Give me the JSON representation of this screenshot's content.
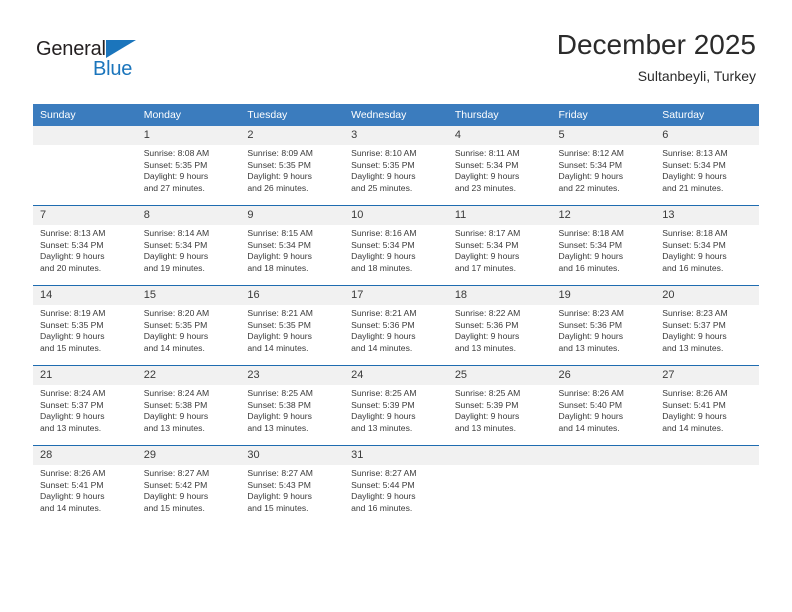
{
  "brand": {
    "name_part1": "General",
    "name_part2": "Blue",
    "accent_color": "#1b75bc"
  },
  "header": {
    "title": "December 2025",
    "location": "Sultanbeyli, Turkey"
  },
  "theme": {
    "header_bg": "#3b7cbe",
    "rule_color": "#1f6cb0",
    "daynum_bg": "#f1f1f1",
    "text_color": "#3a3a3a"
  },
  "weekday_headers": [
    "Sunday",
    "Monday",
    "Tuesday",
    "Wednesday",
    "Thursday",
    "Friday",
    "Saturday"
  ],
  "weeks": [
    [
      {
        "day": "",
        "lines": []
      },
      {
        "day": "1",
        "lines": [
          "Sunrise: 8:08 AM",
          "Sunset: 5:35 PM",
          "Daylight: 9 hours",
          "and 27 minutes."
        ]
      },
      {
        "day": "2",
        "lines": [
          "Sunrise: 8:09 AM",
          "Sunset: 5:35 PM",
          "Daylight: 9 hours",
          "and 26 minutes."
        ]
      },
      {
        "day": "3",
        "lines": [
          "Sunrise: 8:10 AM",
          "Sunset: 5:35 PM",
          "Daylight: 9 hours",
          "and 25 minutes."
        ]
      },
      {
        "day": "4",
        "lines": [
          "Sunrise: 8:11 AM",
          "Sunset: 5:34 PM",
          "Daylight: 9 hours",
          "and 23 minutes."
        ]
      },
      {
        "day": "5",
        "lines": [
          "Sunrise: 8:12 AM",
          "Sunset: 5:34 PM",
          "Daylight: 9 hours",
          "and 22 minutes."
        ]
      },
      {
        "day": "6",
        "lines": [
          "Sunrise: 8:13 AM",
          "Sunset: 5:34 PM",
          "Daylight: 9 hours",
          "and 21 minutes."
        ]
      }
    ],
    [
      {
        "day": "7",
        "lines": [
          "Sunrise: 8:13 AM",
          "Sunset: 5:34 PM",
          "Daylight: 9 hours",
          "and 20 minutes."
        ]
      },
      {
        "day": "8",
        "lines": [
          "Sunrise: 8:14 AM",
          "Sunset: 5:34 PM",
          "Daylight: 9 hours",
          "and 19 minutes."
        ]
      },
      {
        "day": "9",
        "lines": [
          "Sunrise: 8:15 AM",
          "Sunset: 5:34 PM",
          "Daylight: 9 hours",
          "and 18 minutes."
        ]
      },
      {
        "day": "10",
        "lines": [
          "Sunrise: 8:16 AM",
          "Sunset: 5:34 PM",
          "Daylight: 9 hours",
          "and 18 minutes."
        ]
      },
      {
        "day": "11",
        "lines": [
          "Sunrise: 8:17 AM",
          "Sunset: 5:34 PM",
          "Daylight: 9 hours",
          "and 17 minutes."
        ]
      },
      {
        "day": "12",
        "lines": [
          "Sunrise: 8:18 AM",
          "Sunset: 5:34 PM",
          "Daylight: 9 hours",
          "and 16 minutes."
        ]
      },
      {
        "day": "13",
        "lines": [
          "Sunrise: 8:18 AM",
          "Sunset: 5:34 PM",
          "Daylight: 9 hours",
          "and 16 minutes."
        ]
      }
    ],
    [
      {
        "day": "14",
        "lines": [
          "Sunrise: 8:19 AM",
          "Sunset: 5:35 PM",
          "Daylight: 9 hours",
          "and 15 minutes."
        ]
      },
      {
        "day": "15",
        "lines": [
          "Sunrise: 8:20 AM",
          "Sunset: 5:35 PM",
          "Daylight: 9 hours",
          "and 14 minutes."
        ]
      },
      {
        "day": "16",
        "lines": [
          "Sunrise: 8:21 AM",
          "Sunset: 5:35 PM",
          "Daylight: 9 hours",
          "and 14 minutes."
        ]
      },
      {
        "day": "17",
        "lines": [
          "Sunrise: 8:21 AM",
          "Sunset: 5:36 PM",
          "Daylight: 9 hours",
          "and 14 minutes."
        ]
      },
      {
        "day": "18",
        "lines": [
          "Sunrise: 8:22 AM",
          "Sunset: 5:36 PM",
          "Daylight: 9 hours",
          "and 13 minutes."
        ]
      },
      {
        "day": "19",
        "lines": [
          "Sunrise: 8:23 AM",
          "Sunset: 5:36 PM",
          "Daylight: 9 hours",
          "and 13 minutes."
        ]
      },
      {
        "day": "20",
        "lines": [
          "Sunrise: 8:23 AM",
          "Sunset: 5:37 PM",
          "Daylight: 9 hours",
          "and 13 minutes."
        ]
      }
    ],
    [
      {
        "day": "21",
        "lines": [
          "Sunrise: 8:24 AM",
          "Sunset: 5:37 PM",
          "Daylight: 9 hours",
          "and 13 minutes."
        ]
      },
      {
        "day": "22",
        "lines": [
          "Sunrise: 8:24 AM",
          "Sunset: 5:38 PM",
          "Daylight: 9 hours",
          "and 13 minutes."
        ]
      },
      {
        "day": "23",
        "lines": [
          "Sunrise: 8:25 AM",
          "Sunset: 5:38 PM",
          "Daylight: 9 hours",
          "and 13 minutes."
        ]
      },
      {
        "day": "24",
        "lines": [
          "Sunrise: 8:25 AM",
          "Sunset: 5:39 PM",
          "Daylight: 9 hours",
          "and 13 minutes."
        ]
      },
      {
        "day": "25",
        "lines": [
          "Sunrise: 8:25 AM",
          "Sunset: 5:39 PM",
          "Daylight: 9 hours",
          "and 13 minutes."
        ]
      },
      {
        "day": "26",
        "lines": [
          "Sunrise: 8:26 AM",
          "Sunset: 5:40 PM",
          "Daylight: 9 hours",
          "and 14 minutes."
        ]
      },
      {
        "day": "27",
        "lines": [
          "Sunrise: 8:26 AM",
          "Sunset: 5:41 PM",
          "Daylight: 9 hours",
          "and 14 minutes."
        ]
      }
    ],
    [
      {
        "day": "28",
        "lines": [
          "Sunrise: 8:26 AM",
          "Sunset: 5:41 PM",
          "Daylight: 9 hours",
          "and 14 minutes."
        ]
      },
      {
        "day": "29",
        "lines": [
          "Sunrise: 8:27 AM",
          "Sunset: 5:42 PM",
          "Daylight: 9 hours",
          "and 15 minutes."
        ]
      },
      {
        "day": "30",
        "lines": [
          "Sunrise: 8:27 AM",
          "Sunset: 5:43 PM",
          "Daylight: 9 hours",
          "and 15 minutes."
        ]
      },
      {
        "day": "31",
        "lines": [
          "Sunrise: 8:27 AM",
          "Sunset: 5:44 PM",
          "Daylight: 9 hours",
          "and 16 minutes."
        ]
      },
      {
        "day": "",
        "lines": []
      },
      {
        "day": "",
        "lines": []
      },
      {
        "day": "",
        "lines": []
      }
    ]
  ]
}
